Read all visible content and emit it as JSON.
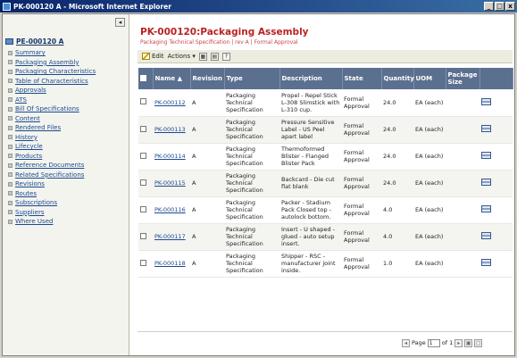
{
  "window": {
    "title": "PK-000120 A - Microsoft Internet Explorer",
    "controls": [
      "_",
      "□",
      "x"
    ]
  },
  "sidebar": {
    "root": "PE-000120 A",
    "items": [
      {
        "label": "Summary"
      },
      {
        "label": "Packaging Assembly",
        "active": true
      },
      {
        "label": "Packaging Characteristics"
      },
      {
        "label": "Table of Characteristics"
      },
      {
        "label": "Approvals"
      },
      {
        "label": "ATS"
      },
      {
        "label": "Bill Of Specifications"
      },
      {
        "label": "Content"
      },
      {
        "label": "Rendered Files"
      },
      {
        "label": "History"
      },
      {
        "label": "Lifecycle"
      },
      {
        "label": "Products"
      },
      {
        "label": "Reference Documents"
      },
      {
        "label": "Related Specifications"
      },
      {
        "label": "Revisions"
      },
      {
        "label": "Routes"
      },
      {
        "label": "Subscriptions"
      },
      {
        "label": "Suppliers"
      },
      {
        "label": "Where Used"
      }
    ]
  },
  "header": {
    "title": "PK-000120:Packaging Assembly",
    "subtitle": "Packaging Technical Specification | rev A | Formal Approval"
  },
  "toolbar": {
    "edit_label": "Edit",
    "actions_label": "Actions ▾"
  },
  "table": {
    "columns": [
      "Name",
      "Revision",
      "Type",
      "Description",
      "State",
      "Quantity",
      "UOM",
      "Package Size"
    ],
    "name_sort_indicator": "▲",
    "rows": [
      {
        "name": "PK-000112",
        "revision": "A",
        "type": "Packaging Technical Specification",
        "description": "Propel - Repel Stick L-308 Slimstick with L-310 cup.",
        "state": "Formal Approval",
        "quantity": "24.0",
        "uom": "EA (each)",
        "package_size": ""
      },
      {
        "name": "PK-000113",
        "revision": "A",
        "type": "Packaging Technical Specification",
        "description": "Pressure Sensitive Label - US Peel apart label",
        "state": "Formal Approval",
        "quantity": "24.0",
        "uom": "EA (each)",
        "package_size": ""
      },
      {
        "name": "PK-000114",
        "revision": "A",
        "type": "Packaging Technical Specification",
        "description": "Thermoformed Blister - Flanged Blister Pack",
        "state": "Formal Approval",
        "quantity": "24.0",
        "uom": "EA (each)",
        "package_size": ""
      },
      {
        "name": "PK-000115",
        "revision": "A",
        "type": "Packaging Technical Specification",
        "description": "Backcard - Die cut flat blank",
        "state": "Formal Approval",
        "quantity": "24.0",
        "uom": "EA (each)",
        "package_size": ""
      },
      {
        "name": "PK-000116",
        "revision": "A",
        "type": "Packaging Technical Specification",
        "description": "Packer - Stadium Pack Closed top - autolock bottom.",
        "state": "Formal Approval",
        "quantity": "4.0",
        "uom": "EA (each)",
        "package_size": ""
      },
      {
        "name": "PK-000117",
        "revision": "A",
        "type": "Packaging Technical Specification",
        "description": "Insert - U shaped - glued - auto setup insert.",
        "state": "Formal Approval",
        "quantity": "4.0",
        "uom": "EA (each)",
        "package_size": ""
      },
      {
        "name": "PK-000118",
        "revision": "A",
        "type": "Packaging Technical Specification",
        "description": "Shipper - RSC - manufacturer joint inside.",
        "state": "Formal Approval",
        "quantity": "1.0",
        "uom": "EA (each)",
        "package_size": ""
      }
    ]
  },
  "pager": {
    "page_label": "Page",
    "current": "1",
    "of_label": "of 1"
  },
  "colors": {
    "title_red": "#b22222",
    "header_bg": "#5b6f8f",
    "link_blue": "#1a4a90",
    "title_bar": "#0a246a"
  }
}
